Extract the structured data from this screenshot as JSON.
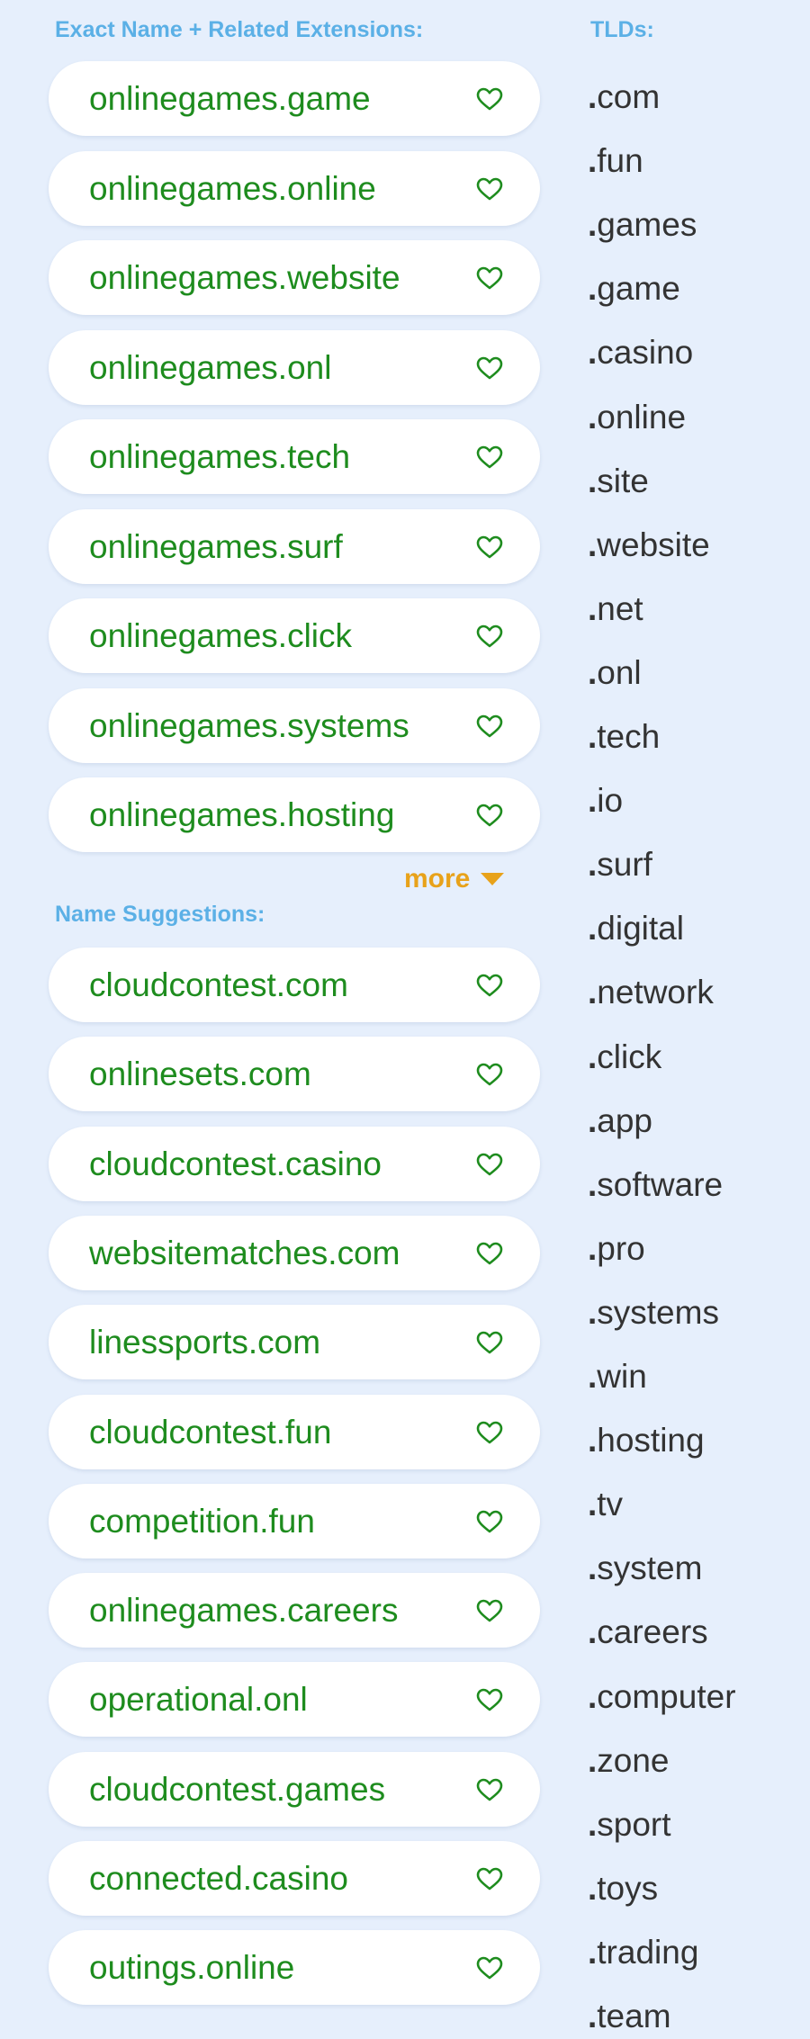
{
  "exact_section": {
    "label": "Exact Name + Related Extensions:",
    "items": [
      {
        "name": "onlinegames.game"
      },
      {
        "name": "onlinegames.online"
      },
      {
        "name": "onlinegames.website"
      },
      {
        "name": "onlinegames.onl"
      },
      {
        "name": "onlinegames.tech"
      },
      {
        "name": "onlinegames.surf"
      },
      {
        "name": "onlinegames.click"
      },
      {
        "name": "onlinegames.systems"
      },
      {
        "name": "onlinegames.hosting"
      }
    ],
    "more_label": "more"
  },
  "suggestions_section": {
    "label": "Name Suggestions:",
    "items": [
      {
        "name": "cloudcontest.com"
      },
      {
        "name": "onlinesets.com"
      },
      {
        "name": "cloudcontest.casino"
      },
      {
        "name": "websitematches.com"
      },
      {
        "name": "linessports.com"
      },
      {
        "name": "cloudcontest.fun"
      },
      {
        "name": "competition.fun"
      },
      {
        "name": "onlinegames.careers"
      },
      {
        "name": "operational.onl"
      },
      {
        "name": "cloudcontest.games"
      },
      {
        "name": "connected.casino"
      },
      {
        "name": "outings.online"
      }
    ]
  },
  "tlds_section": {
    "label": "TLDs:",
    "items": [
      "com",
      "fun",
      "games",
      "game",
      "casino",
      "online",
      "site",
      "website",
      "net",
      "onl",
      "tech",
      "io",
      "surf",
      "digital",
      "network",
      "click",
      "app",
      "software",
      "pro",
      "systems",
      "win",
      "hosting",
      "tv",
      "system",
      "careers",
      "computer",
      "zone",
      "sport",
      "toys",
      "trading",
      "team"
    ]
  },
  "icons": {
    "favorite": "heart-outline-icon",
    "expand": "triangle-down-icon"
  },
  "colors": {
    "background": "#e6effc",
    "domain_text": "#1e8c1e",
    "section_label": "#5bb0e6",
    "more": "#e8a21a",
    "tld_text": "#333333"
  }
}
